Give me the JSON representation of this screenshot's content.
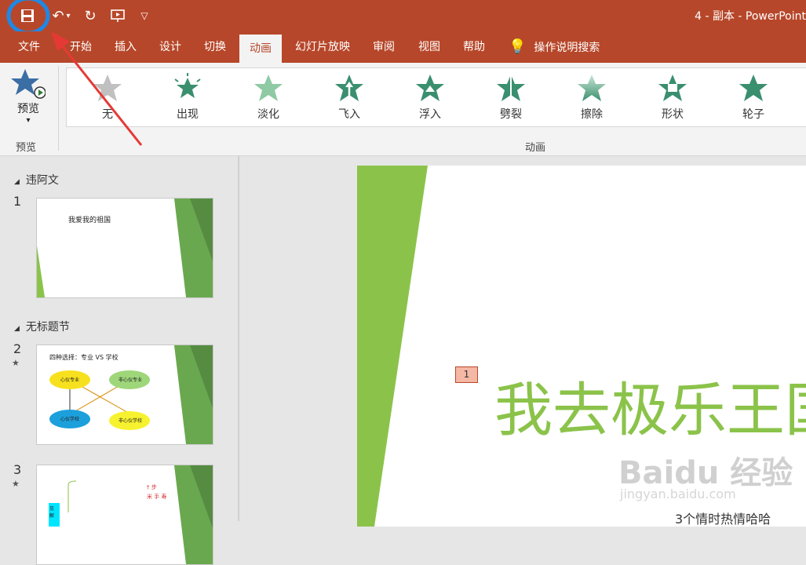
{
  "qat": {
    "save": "save",
    "undo": "undo",
    "redo": "repeat",
    "present": "present-from-start",
    "customize": "customize"
  },
  "window": {
    "title": "4 - 副本  -  PowerPoint"
  },
  "tabs": [
    "文件",
    "开始",
    "插入",
    "设计",
    "切换",
    "动画",
    "幻灯片放映",
    "审阅",
    "视图",
    "帮助"
  ],
  "search": {
    "label": "操作说明搜索"
  },
  "ribbon": {
    "preview_label": "预览",
    "preview_group": "预览",
    "animation_group": "动画",
    "animations": [
      "无",
      "出现",
      "淡化",
      "飞入",
      "浮入",
      "劈裂",
      "擦除",
      "形状",
      "轮子"
    ]
  },
  "thumbnails": {
    "section1": "违阿文",
    "section2": "无标题节",
    "slide1": {
      "num": "1",
      "text": "我爱我的祖国"
    },
    "slide2": {
      "num": "2",
      "heading": "四种选择：专业 VS 学校",
      "nodes": [
        "心仪专业",
        "非心仪专业",
        "心仪学校",
        "非心仪学校"
      ]
    },
    "slide3": {
      "num": "3",
      "label": "见解"
    }
  },
  "editor": {
    "badge": "1",
    "title": "我去极乐王国",
    "subtitle": "3个情时热情哈哈",
    "watermark": "Baidu 经验",
    "watermark_url": "jingyan.baidu.com"
  },
  "colors": {
    "accent": "#b7472a",
    "green": "#8bc34a",
    "annotation": "#1e88e5",
    "arrow": "#e53935"
  }
}
